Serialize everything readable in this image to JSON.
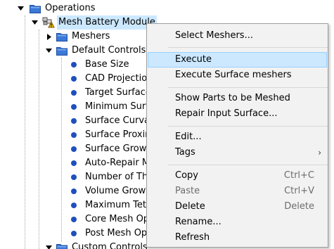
{
  "tree": {
    "operations": {
      "label": "Operations",
      "icon": "folder-icon"
    },
    "mesh_module": {
      "label": "Mesh Battery Module",
      "icon": "mesh-operation-warning-icon"
    },
    "meshers": {
      "label": "Meshers",
      "icon": "folder-icon"
    },
    "default_controls": {
      "label": "Default Controls",
      "icon": "folder-icon"
    },
    "controls": [
      "Base Size",
      "CAD Projection",
      "Target Surface",
      "Minimum Surf",
      "Surface Curvat",
      "Surface Proxin",
      "Surface Growt",
      "Auto-Repair M",
      "Number of Th",
      "Volume Growt",
      "Maximum Tet",
      "Core Mesh Op",
      "Post Mesh Opt"
    ],
    "custom_controls": {
      "label": "Custom Controls",
      "icon": "folder-icon"
    }
  },
  "menu": {
    "select_meshers": "Select Meshers...",
    "execute": "Execute",
    "execute_surface": "Execute Surface meshers",
    "show_parts": "Show Parts to be Meshed",
    "repair_input": "Repair Input Surface...",
    "edit": "Edit...",
    "tags": "Tags",
    "copy": "Copy",
    "copy_key": "Ctrl+C",
    "paste": "Paste",
    "paste_key": "Ctrl+V",
    "delete": "Delete",
    "delete_key": "Delete",
    "rename": "Rename...",
    "refresh": "Refresh"
  },
  "colors": {
    "selection": "#cce8ff",
    "folder": "#3b78d8",
    "dot": "#1f4fbf",
    "menu_bg": "#f2f2f2",
    "disabled_text": "#6d6d6d"
  }
}
